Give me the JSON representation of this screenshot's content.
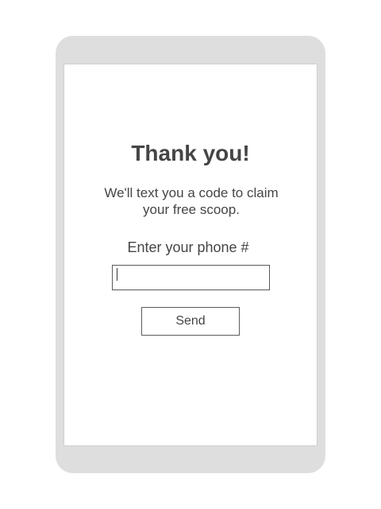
{
  "confirmation": {
    "title": "Thank you!",
    "message": "We'll text you a code to claim your free scoop."
  },
  "phone_form": {
    "label": "Enter your phone #",
    "input_value": "",
    "input_placeholder": "",
    "send_label": "Send"
  }
}
